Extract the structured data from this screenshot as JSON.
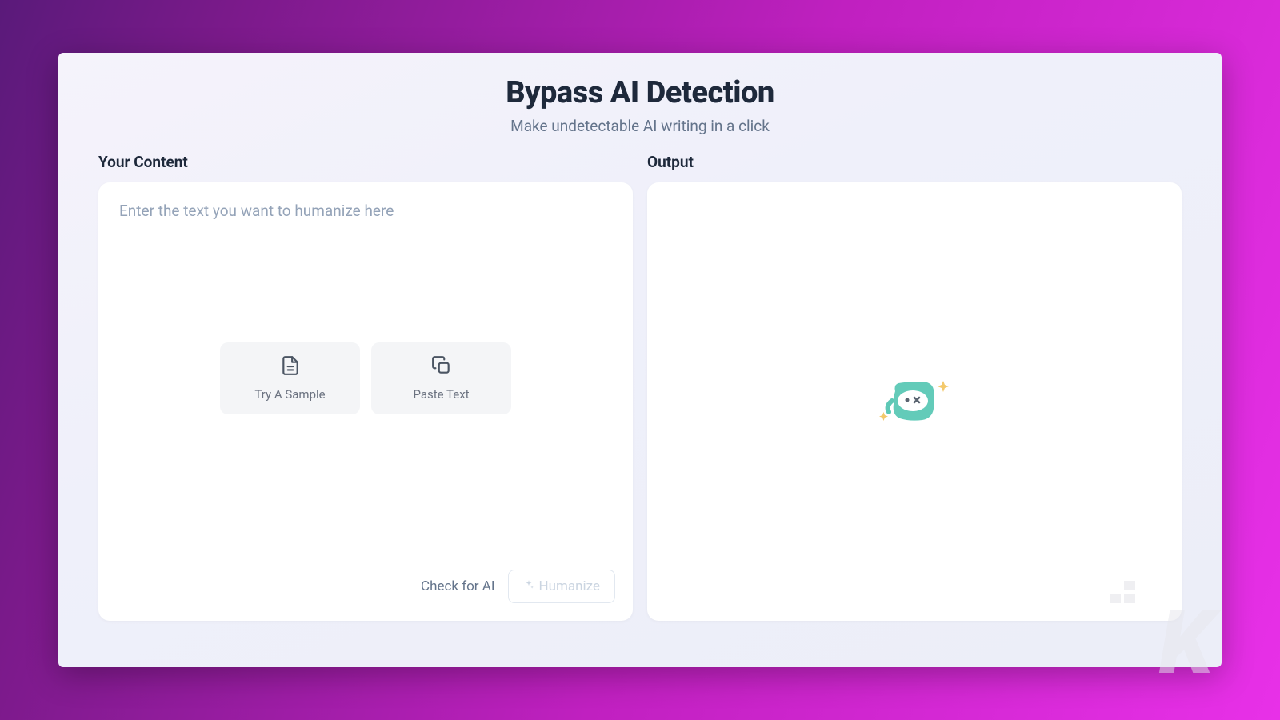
{
  "header": {
    "title": "Bypass AI Detection",
    "subtitle": "Make undetectable AI writing in a click"
  },
  "input": {
    "label": "Your Content",
    "placeholder": "Enter the text you want to humanize here",
    "value": "",
    "quick_actions": {
      "sample": "Try A Sample",
      "paste": "Paste Text"
    },
    "bottom": {
      "check": "Check for AI",
      "humanize": "Humanize"
    }
  },
  "output": {
    "label": "Output"
  },
  "watermark": "K"
}
